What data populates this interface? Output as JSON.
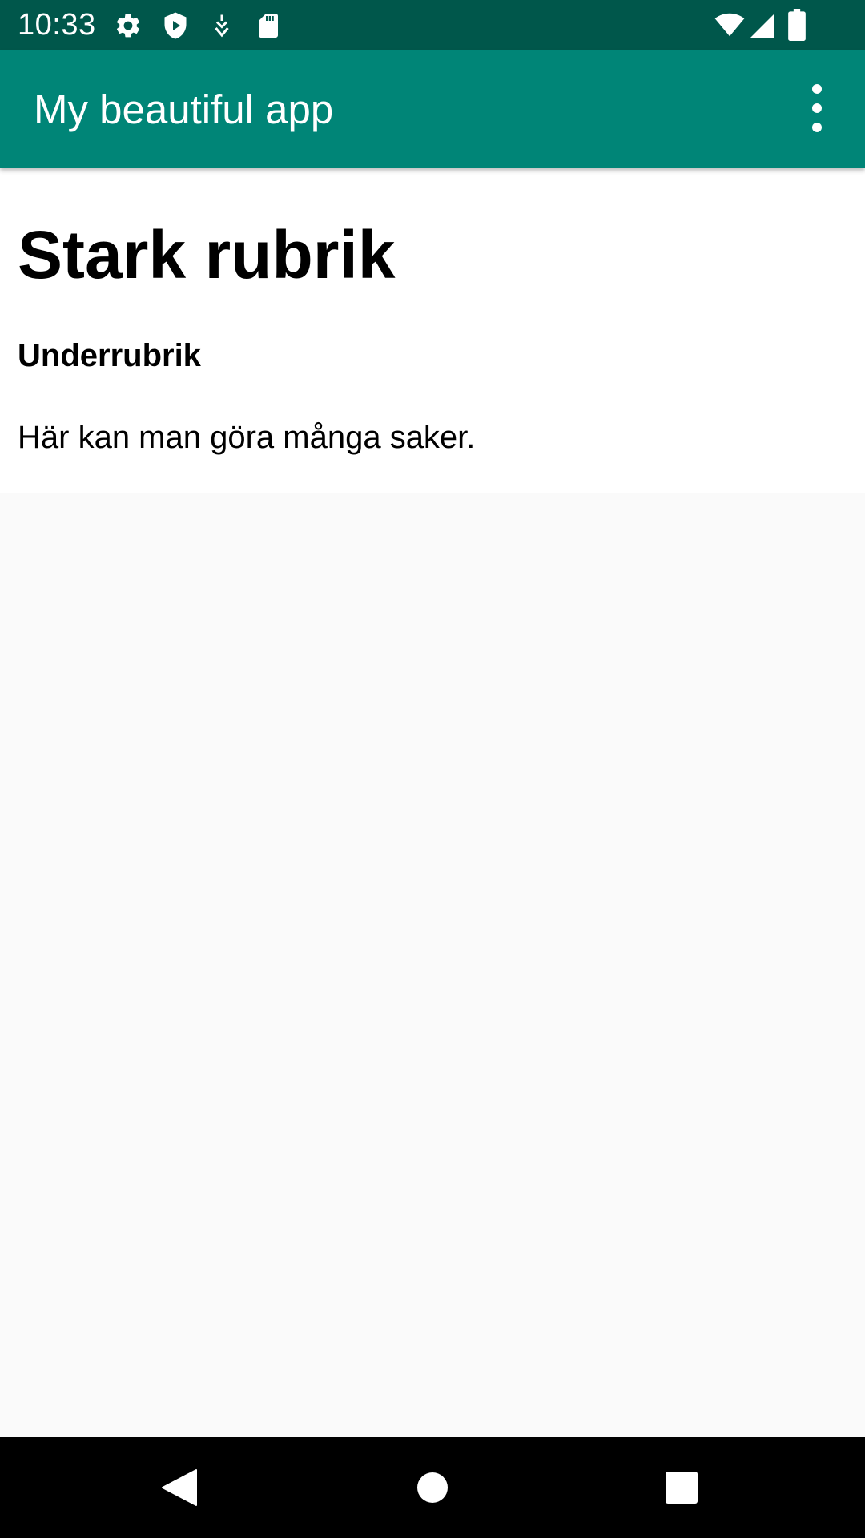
{
  "status_bar": {
    "time": "10:33",
    "left_icons": [
      "settings-icon",
      "shield-play-icon",
      "usb-debug-icon",
      "sd-card-icon"
    ],
    "right_icons": [
      "wifi-icon",
      "cell-signal-icon",
      "battery-icon"
    ],
    "background": "#00574b"
  },
  "app_bar": {
    "title": "My beautiful app",
    "menu_icon": "more-vert-icon",
    "background": "#008577"
  },
  "content": {
    "heading": "Stark rubrik",
    "subheading": "Underrubrik",
    "body": "Här kan man göra många saker."
  },
  "nav_bar": {
    "buttons": [
      "back-icon",
      "home-icon",
      "recents-icon"
    ]
  }
}
